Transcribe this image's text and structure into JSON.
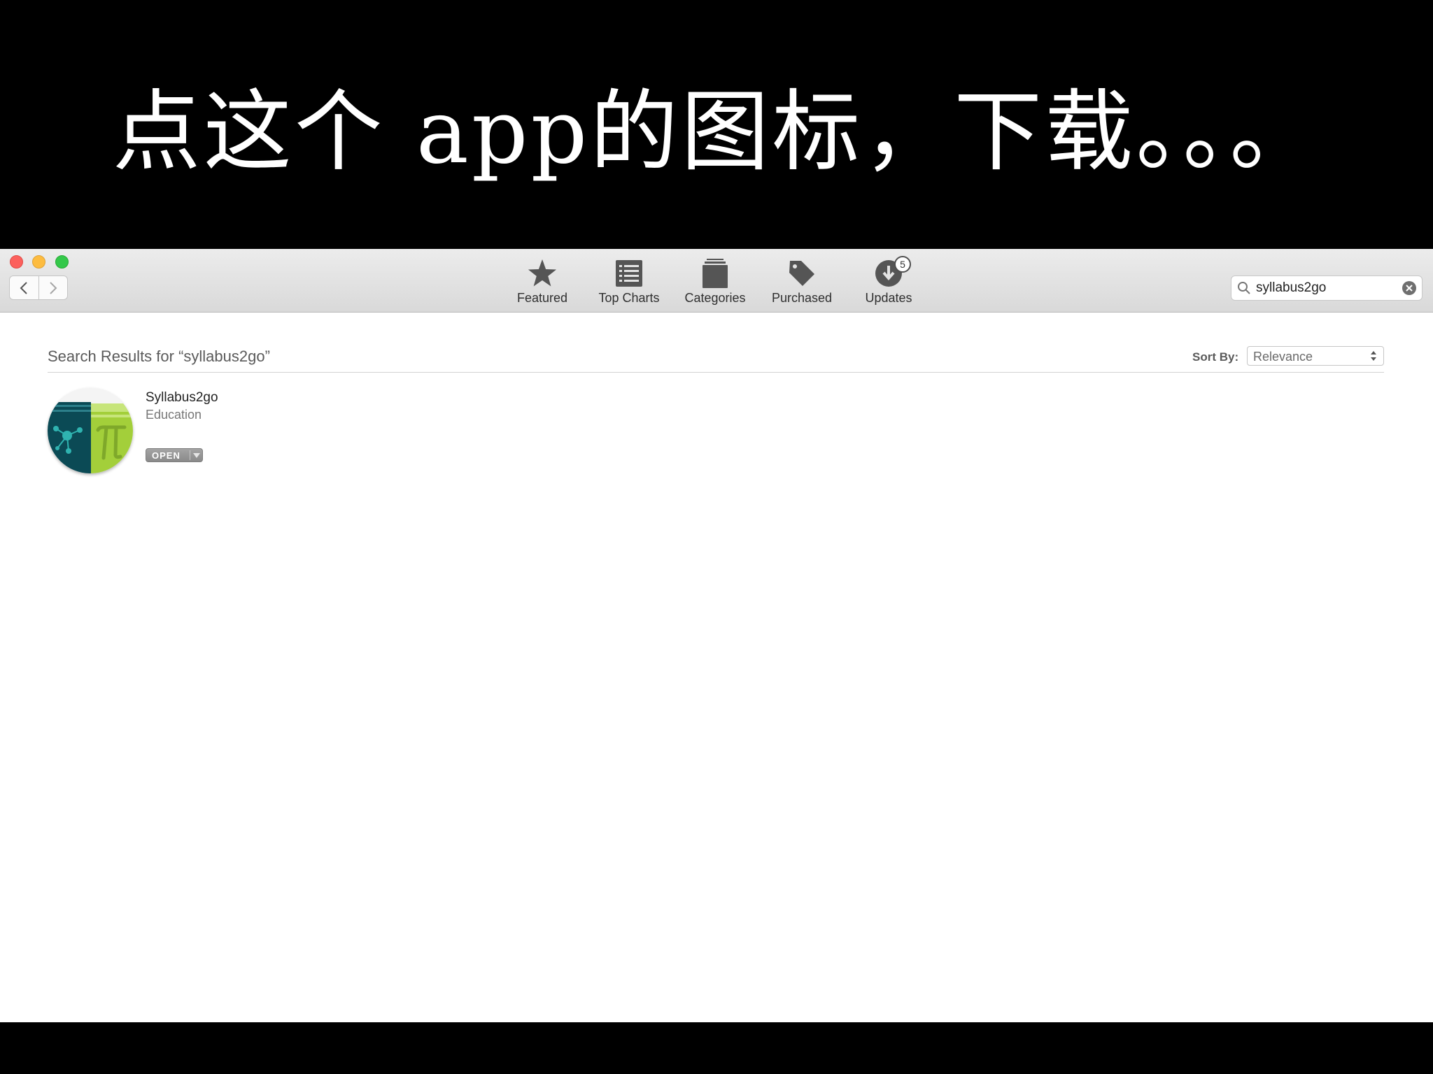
{
  "caption": "点这个 app的图标，下载。。。",
  "toolbar": {
    "tabs": [
      {
        "label": "Featured",
        "icon": "star-icon"
      },
      {
        "label": "Top Charts",
        "icon": "list-icon"
      },
      {
        "label": "Categories",
        "icon": "stack-icon"
      },
      {
        "label": "Purchased",
        "icon": "tag-icon"
      },
      {
        "label": "Updates",
        "icon": "updates-icon",
        "badge": "5"
      }
    ]
  },
  "search": {
    "value": "syllabus2go"
  },
  "results": {
    "title": "Search Results for “syllabus2go”",
    "sort_label": "Sort By:",
    "sort_value": "Relevance",
    "items": [
      {
        "name": "Syllabus2go",
        "category": "Education",
        "action": "OPEN"
      }
    ]
  },
  "colors": {
    "window_bg": "#ffffff",
    "toolbar_top": "#ececec",
    "toolbar_bottom": "#d9d9d9",
    "icon_teal": "#0b4a55",
    "icon_green": "#a3cf3a",
    "close": "#fc605c",
    "minimize": "#fdbc40",
    "maximize": "#34c84a"
  }
}
